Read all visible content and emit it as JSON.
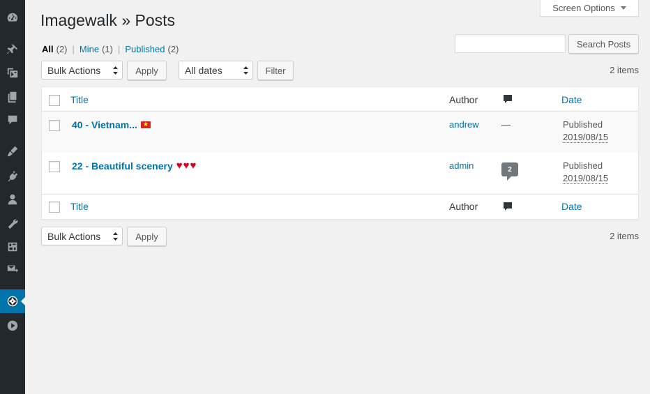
{
  "page": {
    "title": "Imagewalk » Posts"
  },
  "screen_options": {
    "label": "Screen Options"
  },
  "sidebar": {
    "items": [
      {
        "icon": "dashboard-icon"
      },
      {
        "icon": "pin-icon"
      },
      {
        "icon": "media-icon"
      },
      {
        "icon": "pages-icon"
      },
      {
        "icon": "comments-icon"
      },
      {
        "icon": "appearance-icon"
      },
      {
        "icon": "plugins-icon"
      },
      {
        "icon": "users-icon"
      },
      {
        "icon": "tools-icon"
      },
      {
        "icon": "settings-icon"
      },
      {
        "icon": "mail-icon"
      },
      {
        "icon": "imagewalk-aperture-icon",
        "current": true
      },
      {
        "icon": "play-icon"
      }
    ]
  },
  "filters": {
    "all": {
      "label": "All",
      "count": "(2)"
    },
    "mine": {
      "label": "Mine",
      "count": "(1)"
    },
    "published": {
      "label": "Published",
      "count": "(2)"
    },
    "separator": "|"
  },
  "search": {
    "value": "",
    "button_label": "Search Posts"
  },
  "top_actions": {
    "bulk_select": "Bulk Actions",
    "apply_label": "Apply",
    "dates_select": "All dates",
    "filter_label": "Filter",
    "items_count": "2 items"
  },
  "table": {
    "columns": {
      "title": "Title",
      "author": "Author",
      "date": "Date"
    },
    "rows": [
      {
        "title": "40 - Vietnam...",
        "flag": "vietnam-flag",
        "author": "andrew",
        "comments": "—",
        "status": "Published",
        "date": "2019/08/15"
      },
      {
        "title": "22 - Beautiful scenery",
        "hearts": "♥♥♥",
        "author": "admin",
        "comments": "2",
        "status": "Published",
        "date": "2019/08/15"
      }
    ]
  },
  "bottom_actions": {
    "bulk_select": "Bulk Actions",
    "apply_label": "Apply",
    "items_count": "2 items"
  },
  "colors": {
    "accent": "#0073aa",
    "sidebar": "#23282d",
    "background": "#f1f1f1"
  }
}
